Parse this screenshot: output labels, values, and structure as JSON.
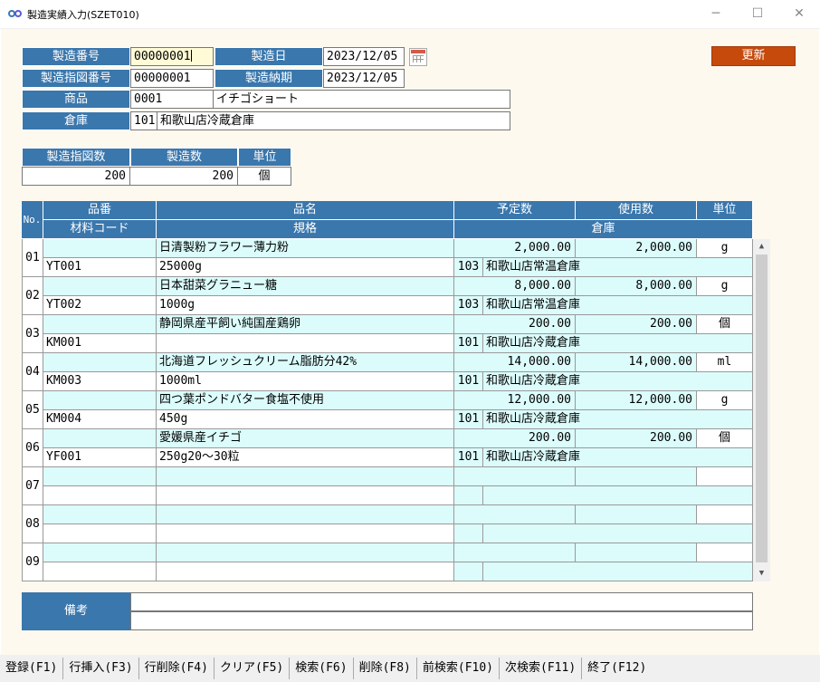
{
  "window": {
    "title": "製造実績入力(SZET010)",
    "minimize": "─",
    "maximize": "☐",
    "close": "✕"
  },
  "header": {
    "production_no_label": "製造番号",
    "production_no": "00000001",
    "production_date_label": "製造日",
    "production_date": "2023/12/05",
    "instruction_no_label": "製造指図番号",
    "instruction_no": "00000001",
    "delivery_label": "製造納期",
    "delivery_date": "2023/12/05",
    "product_label": "商品",
    "product_code": "0001",
    "product_name": "イチゴショート",
    "warehouse_label": "倉庫",
    "warehouse_code": "101",
    "warehouse_name": "和歌山店冷蔵倉庫",
    "update_button": "更新"
  },
  "quantity": {
    "instruction_qty_label": "製造指図数",
    "production_qty_label": "製造数",
    "unit_label": "単位",
    "instruction_qty": "200",
    "production_qty": "200",
    "unit": "個"
  },
  "grid": {
    "headers": {
      "no": "No.",
      "item_code": "品番",
      "material_code": "材料コード",
      "item_name": "品名",
      "spec": "規格",
      "planned": "予定数",
      "used": "使用数",
      "unit": "単位",
      "warehouse": "倉庫"
    },
    "rows": [
      {
        "no": "01",
        "code": "YT001",
        "name": "日清製粉フラワー薄力粉",
        "spec": "25000g",
        "planned": "2,000.00",
        "used": "2,000.00",
        "unit": "g",
        "wh_code": "103",
        "wh_name": "和歌山店常温倉庫"
      },
      {
        "no": "02",
        "code": "YT002",
        "name": "日本甜菜グラニュー糖",
        "spec": "1000g",
        "planned": "8,000.00",
        "used": "8,000.00",
        "unit": "g",
        "wh_code": "103",
        "wh_name": "和歌山店常温倉庫"
      },
      {
        "no": "03",
        "code": "KM001",
        "name": "静岡県産平飼い純国産鶏卵",
        "spec": "",
        "planned": "200.00",
        "used": "200.00",
        "unit": "個",
        "wh_code": "101",
        "wh_name": "和歌山店冷蔵倉庫"
      },
      {
        "no": "04",
        "code": "KM003",
        "name": "北海道フレッシュクリーム脂肪分42%",
        "spec": "1000ml",
        "planned": "14,000.00",
        "used": "14,000.00",
        "unit": "ml",
        "wh_code": "101",
        "wh_name": "和歌山店冷蔵倉庫"
      },
      {
        "no": "05",
        "code": "KM004",
        "name": "四つ葉ポンドバター食塩不使用",
        "spec": "450g",
        "planned": "12,000.00",
        "used": "12,000.00",
        "unit": "g",
        "wh_code": "101",
        "wh_name": "和歌山店冷蔵倉庫"
      },
      {
        "no": "06",
        "code": "YF001",
        "name": "愛媛県産イチゴ",
        "spec": "250g20～30粒",
        "planned": "200.00",
        "used": "200.00",
        "unit": "個",
        "wh_code": "101",
        "wh_name": "和歌山店冷蔵倉庫"
      },
      {
        "no": "07",
        "code": "",
        "name": "",
        "spec": "",
        "planned": "",
        "used": "",
        "unit": "",
        "wh_code": "",
        "wh_name": ""
      },
      {
        "no": "08",
        "code": "",
        "name": "",
        "spec": "",
        "planned": "",
        "used": "",
        "unit": "",
        "wh_code": "",
        "wh_name": ""
      },
      {
        "no": "09",
        "code": "",
        "name": "",
        "spec": "",
        "planned": "",
        "used": "",
        "unit": "",
        "wh_code": "",
        "wh_name": ""
      }
    ]
  },
  "remarks": {
    "label": "備考",
    "line1": "",
    "line2": ""
  },
  "function_keys": [
    "登録(F1)",
    "行挿入(F3)",
    "行削除(F4)",
    "クリア(F5)",
    "検索(F6)",
    "削除(F8)",
    "前検索(F10)",
    "次検索(F11)",
    "終了(F12)"
  ],
  "colors": {
    "header_blue": "#3a77ad",
    "row_cyan": "#dcfcfc",
    "update_orange": "#c54a0c"
  }
}
